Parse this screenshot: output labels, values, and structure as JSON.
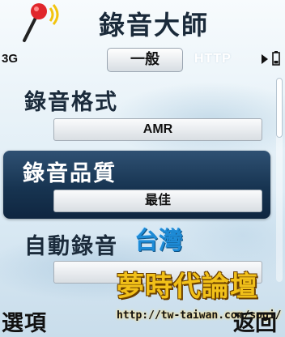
{
  "header": {
    "title": "錄音大師",
    "icon": "microphone-icon"
  },
  "status": {
    "signal": "3G",
    "battery_icon": "battery-icon"
  },
  "tabs": [
    {
      "label": "一般",
      "active": true
    },
    {
      "label": "HTTP",
      "active": false
    }
  ],
  "settings": [
    {
      "label": "錄音格式",
      "value": "AMR",
      "selected": false
    },
    {
      "label": "錄音品質",
      "value": "最佳",
      "selected": true
    },
    {
      "label": "自動錄音",
      "value": "",
      "selected": false
    }
  ],
  "softkeys": {
    "left": "選項",
    "right": "返回"
  },
  "watermark": {
    "region": "台灣",
    "site_name": "夢時代論壇",
    "url": "http://tw-taiwan.com/sogi/"
  },
  "colors": {
    "highlight": "#173451",
    "watermark_gold": "#f1c019",
    "watermark_blue": "#1e8bd6"
  }
}
